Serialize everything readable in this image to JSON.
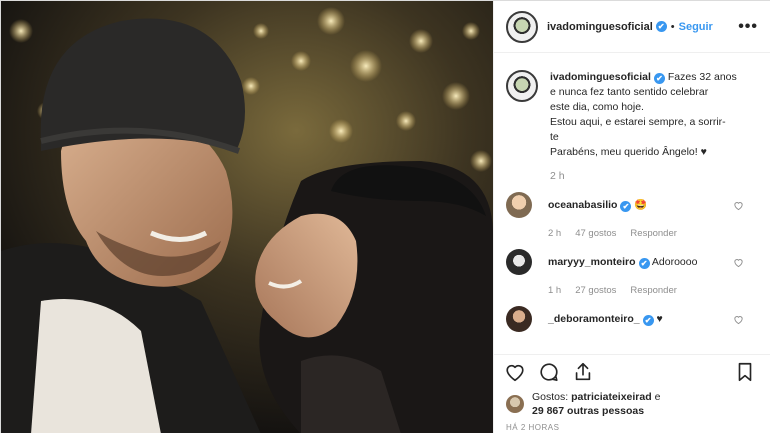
{
  "post": {
    "username": "ivadominguesoficial",
    "verified_mark": "✔",
    "separator": "•",
    "follow_label": "Seguir",
    "more_label": "•••"
  },
  "caption": {
    "username": "ivadominguesoficial",
    "lines": [
      "Fazes 32 anos",
      "e nunca fez tanto sentido celebrar",
      "este dia, como hoje.",
      "Estou aqui, e estarei sempre, a sorrir-",
      "te",
      "Parabéns, meu querido Ângelo! ♥"
    ],
    "time": "2 h"
  },
  "comments": [
    {
      "username": "oceanabasilio",
      "text": "🤩",
      "time": "2 h",
      "likes": "47 gostos",
      "reply": "Responder"
    },
    {
      "username": "maryyy_monteiro",
      "text": "Adoroooo",
      "time": "1 h",
      "likes": "27 gostos",
      "reply": "Responder"
    },
    {
      "username": "_deboramonteiro_",
      "text": "♥"
    }
  ],
  "likes": {
    "prefix": "Gostos:",
    "first_user": "patriciateixeirad",
    "conjunction": "e",
    "others": "29 867 outras pessoas"
  },
  "time_ago": "HÁ 2 HORAS",
  "icons": [
    "heart-icon",
    "comment-icon",
    "share-icon",
    "bookmark-icon",
    "verified-icon",
    "more-icon"
  ],
  "colors": {
    "accent": "#3897f0",
    "muted": "#8e8e8e",
    "text": "#262626"
  }
}
